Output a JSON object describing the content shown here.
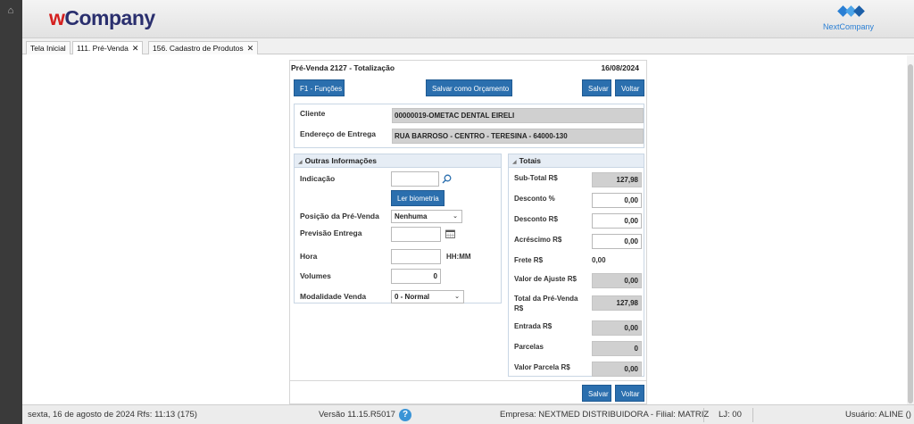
{
  "header": {
    "logo_w": "w",
    "logo_rest": "Company",
    "next_logo": "NextCompany"
  },
  "tabs": [
    {
      "label": "Tela Inicial"
    },
    {
      "label": "111. Pré-Venda"
    },
    {
      "label": "156. Cadastro de Produtos"
    }
  ],
  "panel": {
    "title": "Pré-Venda 2127 - Totalização",
    "date": "16/08/2024",
    "btn_funcoes": "F1 - Funções",
    "btn_salvar_orcamento": "Salvar como Orçamento",
    "btn_salvar": "Salvar",
    "btn_voltar": "Voltar"
  },
  "cliente": {
    "label": "Cliente",
    "value": "00000019-OMETAC DENTAL EIRELI",
    "endereco_label": "Endereço de Entrega",
    "endereco_value": "RUA BARROSO - CENTRO - TERESINA - 64000-130"
  },
  "outras": {
    "title": "Outras Informações",
    "indicacao_label": "Indicação",
    "indicacao_value": "",
    "ler_biometria": "Ler biometria",
    "posicao_label": "Posição da Pré-Venda",
    "posicao_value": "Nenhuma",
    "previsao_label": "Previsão Entrega",
    "previsao_value": "",
    "hora_label": "Hora",
    "hora_value": "",
    "hora_hint": "HH:MM",
    "volumes_label": "Volumes",
    "volumes_value": "0",
    "modalidade_label": "Modalidade Venda",
    "modalidade_value": "0 - Normal"
  },
  "totais": {
    "title": "Totais",
    "subtotal_label": "Sub-Total R$",
    "subtotal_value": "127,98",
    "desconto_pct_label": "Desconto %",
    "desconto_pct_value": "0,00",
    "desconto_rs_label": "Desconto R$",
    "desconto_rs_value": "0,00",
    "acrescimo_label": "Acréscimo R$",
    "acrescimo_value": "0,00",
    "frete_label": "Frete R$",
    "frete_value": "0,00",
    "ajuste_label": "Valor de Ajuste R$",
    "ajuste_value": "0,00",
    "total_label_1": "Total da Pré-Venda",
    "total_label_2": "R$",
    "total_value": "127,98",
    "entrada_label": "Entrada R$",
    "entrada_value": "0,00",
    "parcelas_label": "Parcelas",
    "parcelas_value": "0",
    "valor_parcela_label": "Valor Parcela R$",
    "valor_parcela_value": "0,00"
  },
  "status": {
    "date": "sexta, 16 de agosto de 2024  Rfs: 11:13 (175)",
    "version": "Versão 11.15.R5017",
    "help": "?",
    "empresa": "Empresa: NEXTMED DISTRIBUIDORA - Filial: MATRIZ",
    "lj": "LJ: 00",
    "usuario": "Usuário: ALINE ()"
  }
}
